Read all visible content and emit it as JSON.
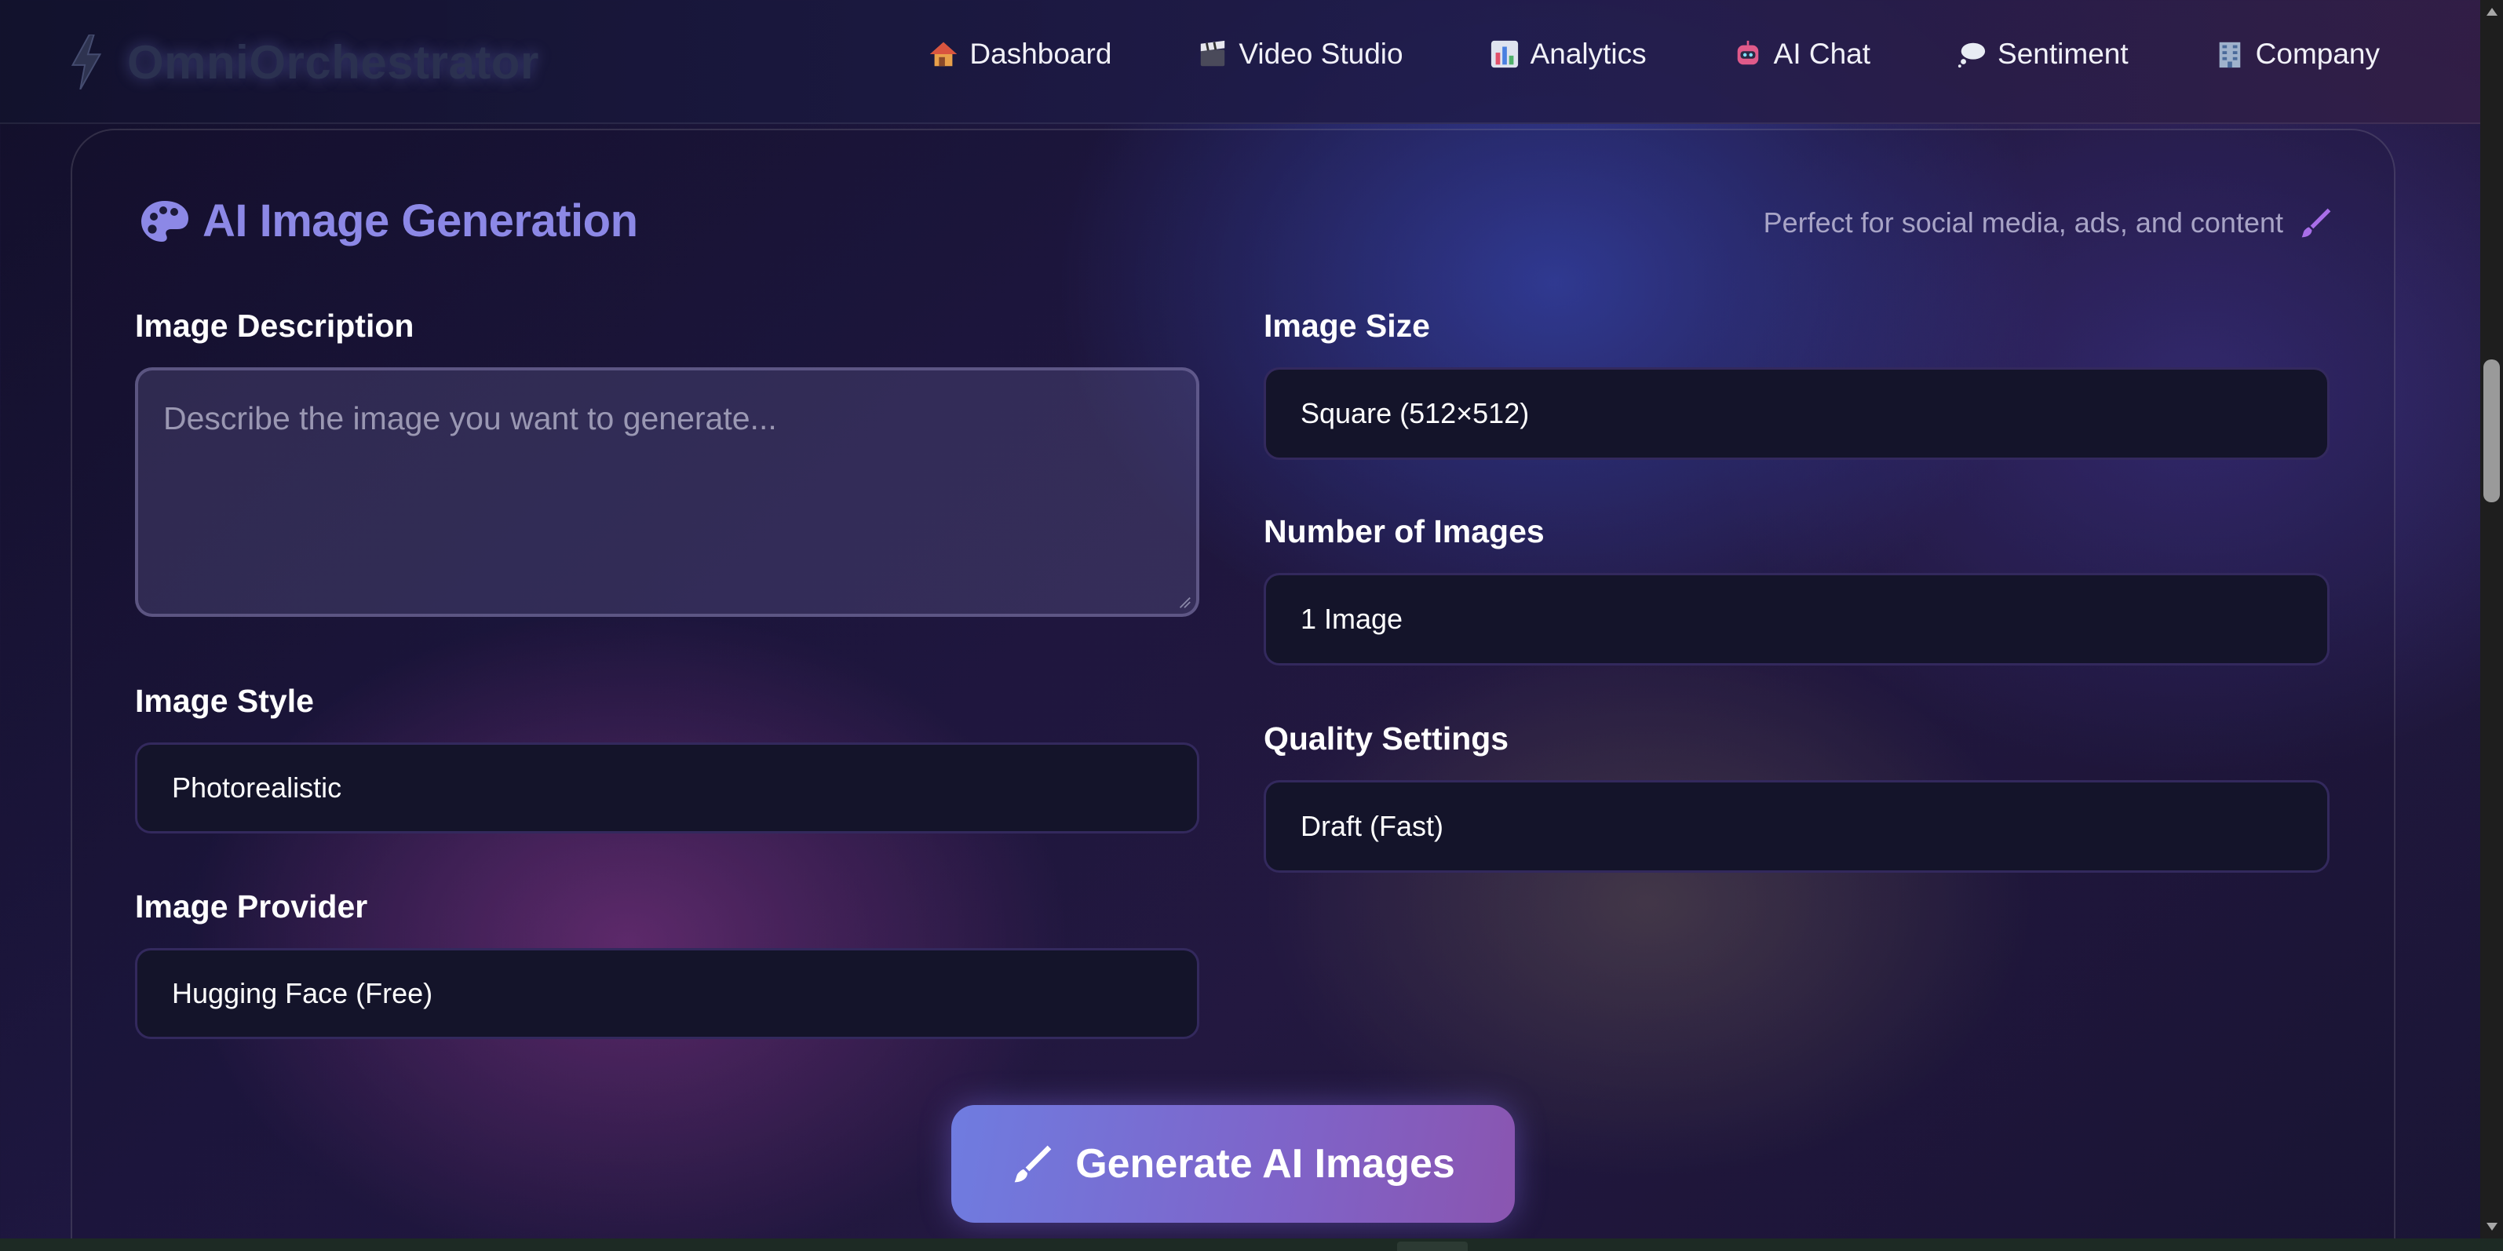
{
  "app": {
    "brand_name": "OmniOrchestrator",
    "brand_icon": "lightning-icon"
  },
  "nav": {
    "items": [
      {
        "label": "Dashboard",
        "icon": "house-icon"
      },
      {
        "label": "Video Studio",
        "icon": "clapperboard-icon"
      },
      {
        "label": "Analytics",
        "icon": "bar-chart-icon"
      },
      {
        "label": "AI Chat",
        "icon": "robot-icon"
      },
      {
        "label": "Sentiment",
        "icon": "thought-bubble-icon"
      },
      {
        "label": "Company",
        "icon": "office-building-icon"
      }
    ]
  },
  "section": {
    "title": "AI Image Generation",
    "title_icon": "palette-icon",
    "subtitle": "Perfect for social media, ads, and content",
    "subtitle_icon": "paintbrush-icon"
  },
  "form": {
    "description": {
      "label": "Image Description",
      "placeholder": "Describe the image you want to generate...",
      "value": ""
    },
    "style": {
      "label": "Image Style",
      "value": "Photorealistic"
    },
    "provider": {
      "label": "Image Provider",
      "value": "Hugging Face (Free)"
    },
    "size": {
      "label": "Image Size",
      "value": "Square (512×512)"
    },
    "count": {
      "label": "Number of Images",
      "value": "1 Image"
    },
    "quality": {
      "label": "Quality Settings",
      "value": "Draft (Fast)"
    }
  },
  "actions": {
    "generate_label": "Generate AI Images",
    "generate_icon": "paintbrush-icon"
  },
  "colors": {
    "accent": "#8c88e6",
    "button_start": "#6f7ce0",
    "button_end": "#8a55b0",
    "field_bg": "#14142a"
  }
}
